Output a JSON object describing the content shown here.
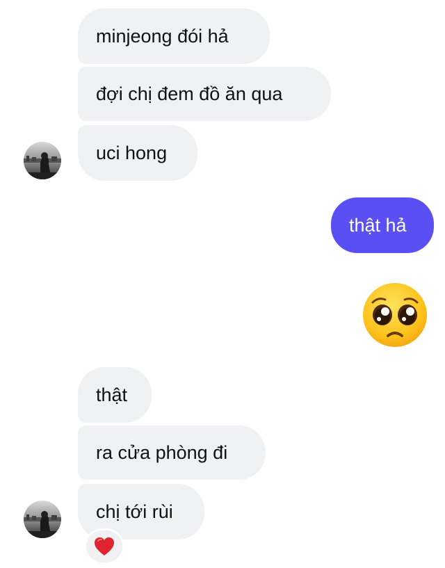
{
  "messages": [
    {
      "text": "minjeong đói hả",
      "direction": "incoming"
    },
    {
      "text": "đợi chị đem đồ ăn qua",
      "direction": "incoming"
    },
    {
      "text": "uci hong",
      "direction": "incoming"
    },
    {
      "text": "thật hả",
      "direction": "outgoing"
    },
    {
      "emoji": "pleading-face",
      "direction": "outgoing"
    },
    {
      "text": "thật",
      "direction": "incoming"
    },
    {
      "text": "ra cửa phòng đi",
      "direction": "incoming"
    },
    {
      "text": "chị tới rùi",
      "direction": "incoming",
      "reaction": "heart"
    }
  ],
  "colors": {
    "incoming_bubble": "#f0f1f3",
    "outgoing_bubble": "#5a4ff3",
    "incoming_text": "#111111",
    "outgoing_text": "#ffffff"
  },
  "icons": {
    "avatar": "contact-avatar-photo",
    "emoji": "pleading-face-emoji",
    "reaction": "red-heart-icon"
  }
}
